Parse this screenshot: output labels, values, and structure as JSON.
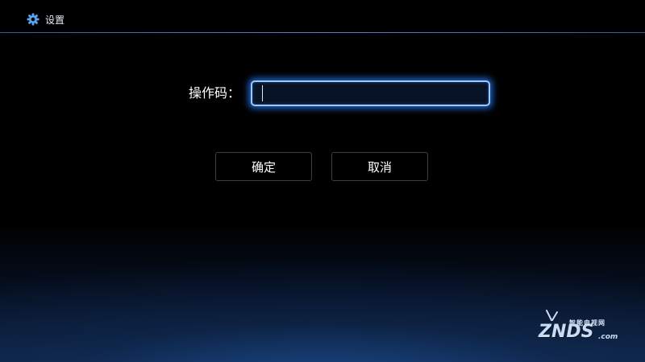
{
  "header": {
    "title": "设置",
    "icon": "gear-icon"
  },
  "form": {
    "code_label": "操作码：",
    "code_value": "",
    "code_placeholder": ""
  },
  "buttons": {
    "ok_label": "确定",
    "cancel_label": "取消"
  },
  "watermark": {
    "top_text": "智能电视网",
    "brand": "ZNDS",
    "suffix": ".com"
  },
  "colors": {
    "accent": "#9cc7ff",
    "focus_glow": "#2373e6",
    "header_line": "#4a86c8",
    "background": "#000000",
    "button_border": "#3a3f47"
  }
}
